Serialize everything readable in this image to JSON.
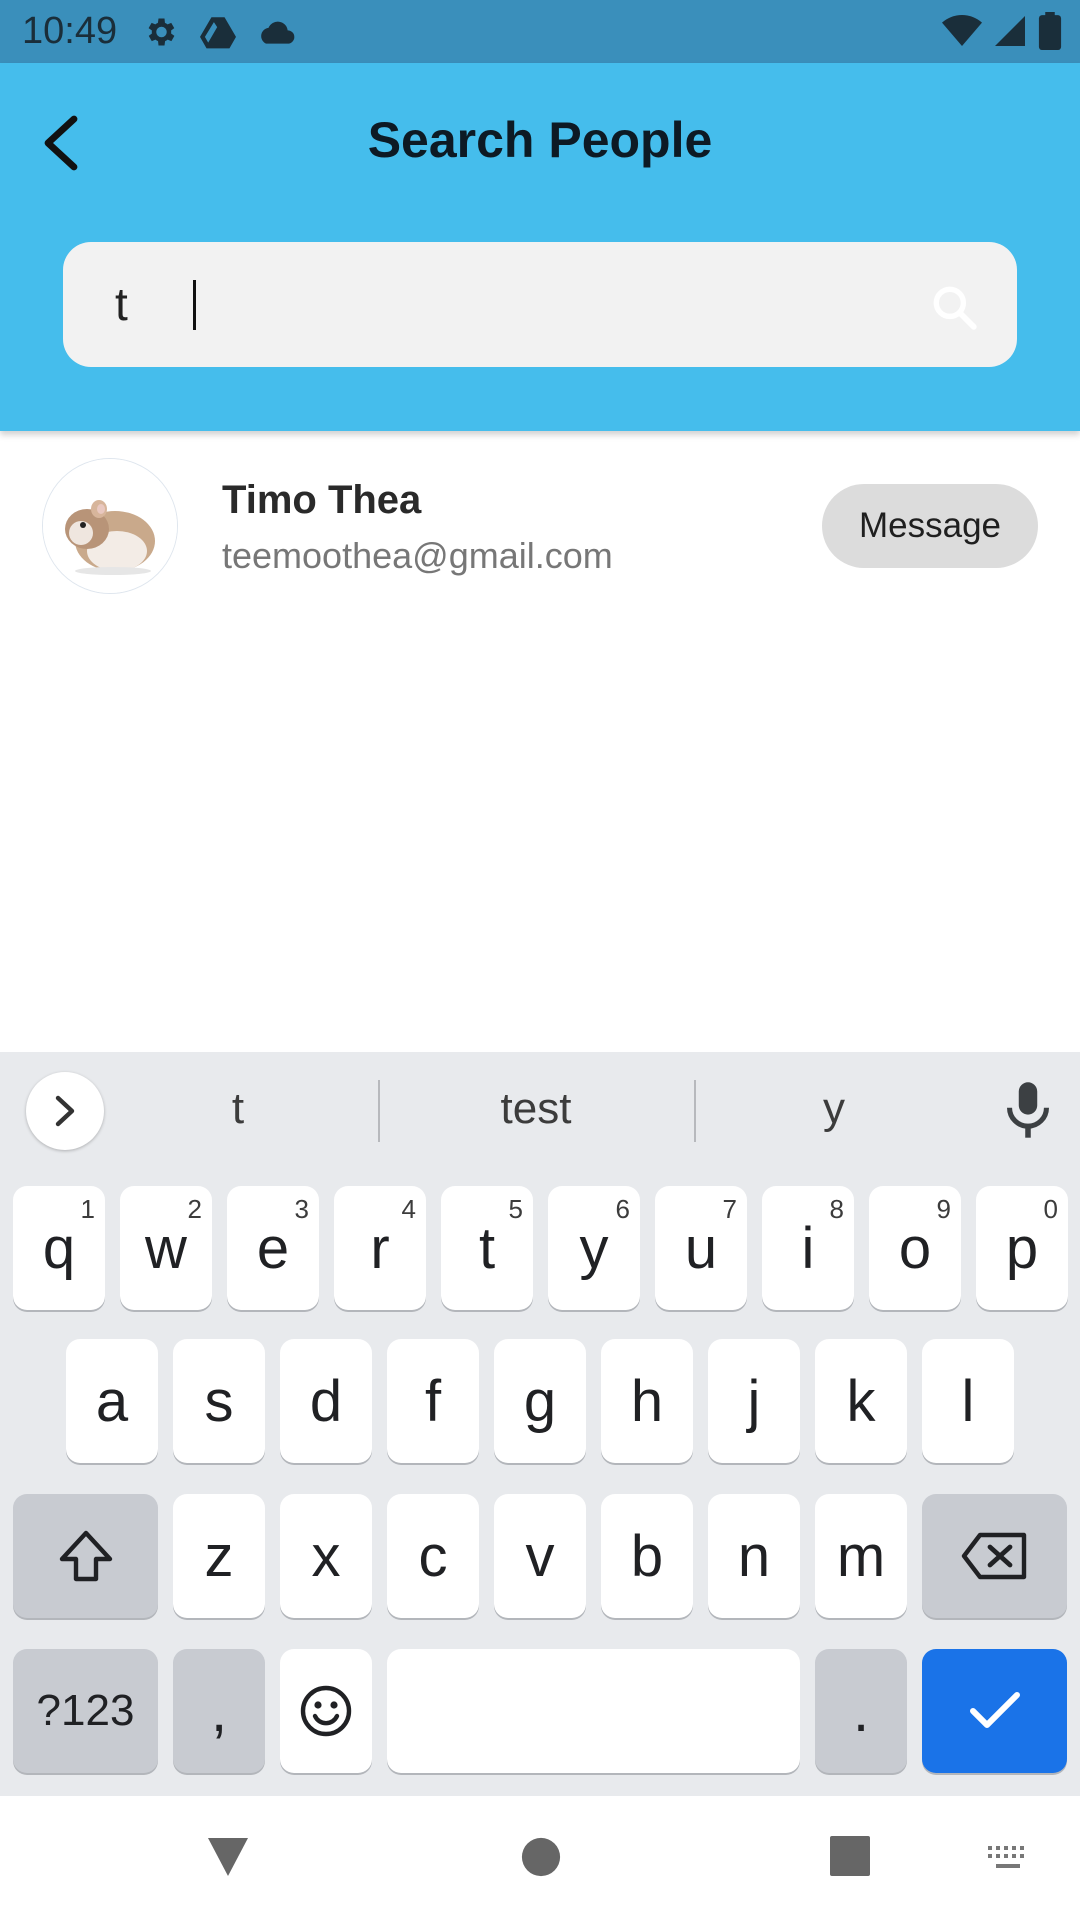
{
  "status_bar": {
    "time": "10:49"
  },
  "app_bar": {
    "title": "Search People"
  },
  "search": {
    "value": "t"
  },
  "results": [
    {
      "name": "Timo Thea",
      "email": "teemoothea@gmail.com",
      "action_label": "Message"
    }
  ],
  "keyboard": {
    "suggestions": [
      "t",
      "test",
      "y"
    ],
    "row1": [
      {
        "k": "q",
        "h": "1"
      },
      {
        "k": "w",
        "h": "2"
      },
      {
        "k": "e",
        "h": "3"
      },
      {
        "k": "r",
        "h": "4"
      },
      {
        "k": "t",
        "h": "5"
      },
      {
        "k": "y",
        "h": "6"
      },
      {
        "k": "u",
        "h": "7"
      },
      {
        "k": "i",
        "h": "8"
      },
      {
        "k": "o",
        "h": "9"
      },
      {
        "k": "p",
        "h": "0"
      }
    ],
    "row2": [
      "a",
      "s",
      "d",
      "f",
      "g",
      "h",
      "j",
      "k",
      "l"
    ],
    "row3": [
      "z",
      "x",
      "c",
      "v",
      "b",
      "n",
      "m"
    ],
    "symbols_label": "?123",
    "comma_label": ",",
    "period_label": "."
  },
  "colors": {
    "app_bar": "#45bdec",
    "status_bar": "#3a8fbb",
    "action_key": "#1a73e8"
  }
}
